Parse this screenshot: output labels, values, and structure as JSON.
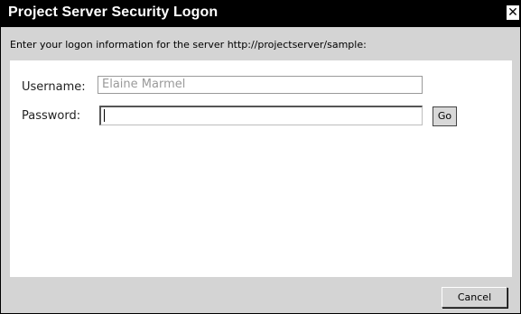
{
  "window": {
    "title": "Project Server Security Logon",
    "close_glyph": "✕"
  },
  "instruction": "Enter your logon information for the server http://projectserver/sample:",
  "form": {
    "username_label": "Username:",
    "username_value": "Elaine Marmel",
    "password_label": "Password:",
    "password_value": "",
    "go_label": "Go"
  },
  "footer": {
    "cancel_label": "Cancel"
  }
}
